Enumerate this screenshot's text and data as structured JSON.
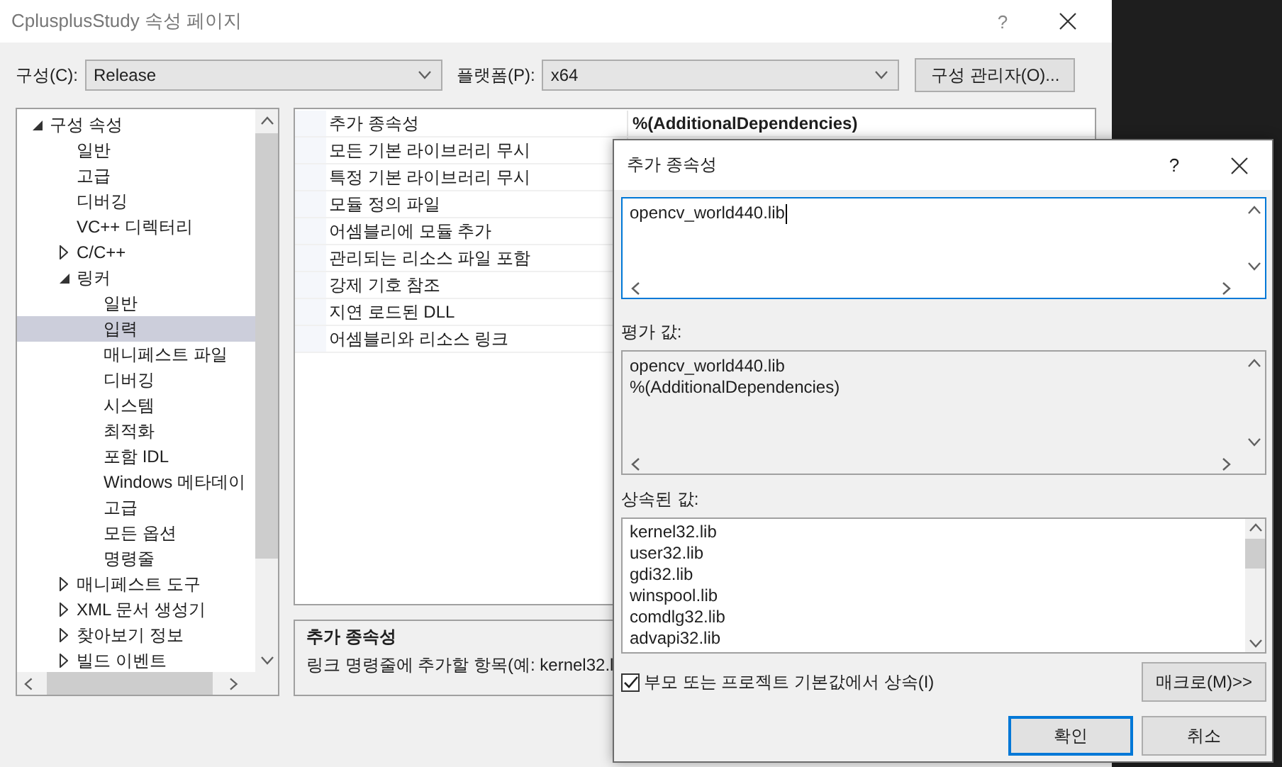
{
  "window": {
    "title": "CplusplusStudy 속성 페이지",
    "help": "?"
  },
  "toolbar": {
    "config_label": "구성(C):",
    "config_value": "Release",
    "platform_label": "플랫폼(P):",
    "platform_value": "x64",
    "manager_button": "구성 관리자(O)..."
  },
  "tree": [
    {
      "label": "구성 속성",
      "selected": false,
      "expanded": true,
      "children": [
        {
          "label": "일반",
          "selected": false
        },
        {
          "label": "고급",
          "selected": false
        },
        {
          "label": "디버깅",
          "selected": false
        },
        {
          "label": "VC++ 디렉터리",
          "selected": false
        },
        {
          "label": "C/C++",
          "selected": false,
          "expanded": false
        },
        {
          "label": "링커",
          "selected": false,
          "expanded": true,
          "children": [
            {
              "label": "일반",
              "selected": false
            },
            {
              "label": "입력",
              "selected": true
            },
            {
              "label": "매니페스트 파일",
              "selected": false
            },
            {
              "label": "디버깅",
              "selected": false
            },
            {
              "label": "시스템",
              "selected": false
            },
            {
              "label": "최적화",
              "selected": false
            },
            {
              "label": "포함 IDL",
              "selected": false
            },
            {
              "label": "Windows 메타데이",
              "selected": false
            },
            {
              "label": "고급",
              "selected": false
            },
            {
              "label": "모든 옵션",
              "selected": false
            },
            {
              "label": "명령줄",
              "selected": false
            }
          ]
        },
        {
          "label": "매니페스트 도구",
          "selected": false,
          "expanded": false
        },
        {
          "label": "XML 문서 생성기",
          "selected": false,
          "expanded": false
        },
        {
          "label": "찾아보기 정보",
          "selected": false,
          "expanded": false
        },
        {
          "label": "빌드 이벤트",
          "selected": false,
          "expanded": false
        }
      ]
    }
  ],
  "properties": [
    {
      "name": "추가 종속성",
      "value": "%(AdditionalDependencies)"
    },
    {
      "name": "모든 기본 라이브러리 무시"
    },
    {
      "name": "특정 기본 라이브러리 무시"
    },
    {
      "name": "모듈 정의 파일"
    },
    {
      "name": "어셈블리에 모듈 추가"
    },
    {
      "name": "관리되는 리소스 파일 포함"
    },
    {
      "name": "강제 기호 참조"
    },
    {
      "name": "지연 로드된 DLL"
    },
    {
      "name": "어셈블리와 리소스 링크"
    }
  ],
  "description": {
    "title": "추가 종속성",
    "text": "링크 명령줄에 추가할 항목(예: kernel32.l"
  },
  "dialog": {
    "title": "추가 종속성",
    "help": "?",
    "edit_value": "opencv_world440.lib",
    "evaluated_label": "평가 값:",
    "evaluated_lines": [
      "opencv_world440.lib",
      "%(AdditionalDependencies)"
    ],
    "inherited_label": "상속된 값:",
    "inherited_lines": [
      "kernel32.lib",
      "user32.lib",
      "gdi32.lib",
      "winspool.lib",
      "comdlg32.lib",
      "advapi32.lib"
    ],
    "inherit_checkbox": {
      "label": "부모 또는 프로젝트 기본값에서 상속(I)",
      "checked": true
    },
    "macro_button": "매크로(M)>>",
    "ok_button": "확인",
    "cancel_button": "취소"
  }
}
